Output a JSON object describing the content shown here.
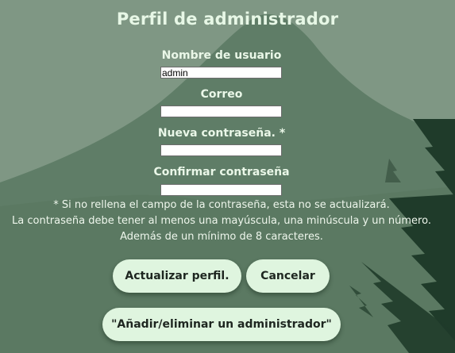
{
  "page": {
    "title": "Perfil de administrador"
  },
  "form": {
    "username": {
      "label": "Nombre de usuario",
      "value": "admin"
    },
    "email": {
      "label": "Correo",
      "value": ""
    },
    "new_password": {
      "label": "Nueva contraseña. *",
      "value": ""
    },
    "confirm_password": {
      "label": "Confirmar contraseña",
      "value": ""
    }
  },
  "notes": {
    "line1": "* Si no rellena el campo de la contraseña, esta no se actualizará.",
    "line2": "La contraseña debe tener al menos una mayúscula, una minúscula y un número.",
    "line3": "Además de un mínimo de 8 caracteres."
  },
  "buttons": {
    "update": "Actualizar perfil.",
    "cancel": "Cancelar",
    "manage_admins": "\"Añadir/eliminar un administrador\""
  },
  "colors": {
    "background": "#7b9481",
    "mountain": "#5d7b65",
    "tree": "#223d2c",
    "button_fill": "#dff5df",
    "text_light": "#e7f7e6"
  }
}
